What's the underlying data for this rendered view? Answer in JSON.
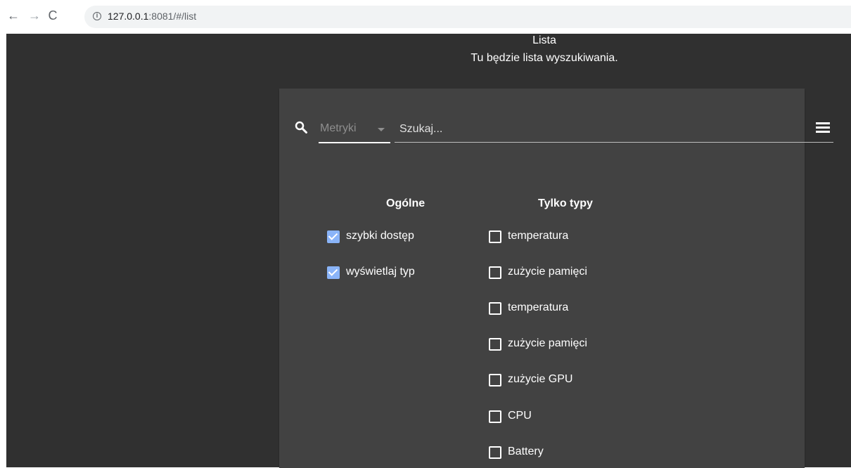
{
  "browser": {
    "back_glyph": "←",
    "forward_glyph": "→",
    "reload_glyph": "C",
    "url_host": "127.0.0.1",
    "url_rest": ":8081/#/list"
  },
  "page": {
    "title": "Lista",
    "subtitle": "Tu będzie lista wyszukiwania."
  },
  "search": {
    "type_select_label": "Metryki",
    "placeholder": "Szukaj..."
  },
  "columns": {
    "general": {
      "heading": "Ogólne",
      "items": [
        {
          "label": "szybki dostęp",
          "checked": true
        },
        {
          "label": "wyświetlaj typ",
          "checked": true
        }
      ]
    },
    "types": {
      "heading": "Tylko typy",
      "items": [
        {
          "label": "temperatura",
          "checked": false
        },
        {
          "label": "zużycie pamięci",
          "checked": false
        },
        {
          "label": "temperatura",
          "checked": false
        },
        {
          "label": "zużycie pamięci",
          "checked": false
        },
        {
          "label": "zużycie GPU",
          "checked": false
        },
        {
          "label": "CPU",
          "checked": false
        },
        {
          "label": "Battery",
          "checked": false
        }
      ]
    }
  },
  "colors": {
    "background": "#303030",
    "card": "#424242",
    "checkbox_checked": "#8ab4f8",
    "text": "#ffffff"
  }
}
